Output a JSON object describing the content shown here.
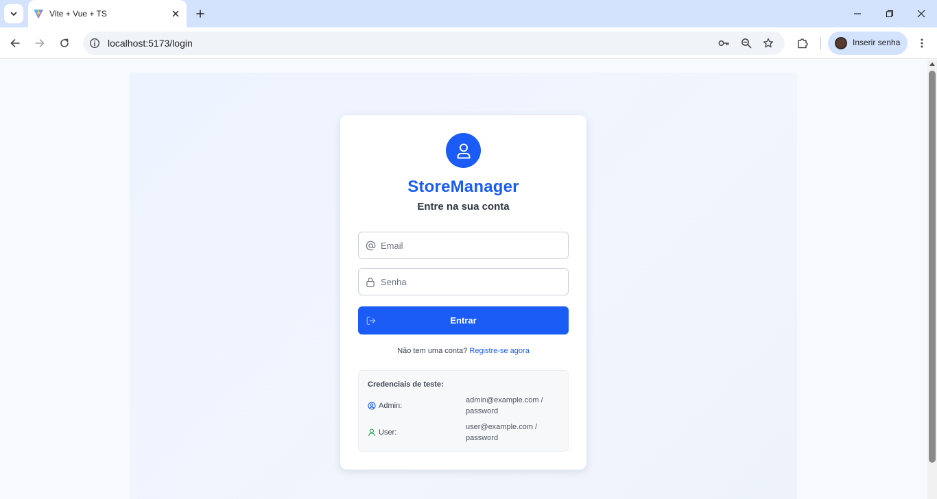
{
  "browser": {
    "tab_title": "Vite + Vue + TS",
    "url": "localhost:5173/login",
    "profile_label": "Inserir senha"
  },
  "login": {
    "brand": "StoreManager",
    "subtitle": "Entre na sua conta",
    "email_placeholder": "Email",
    "password_placeholder": "Senha",
    "submit_label": "Entrar",
    "register_prompt": "Não tem uma conta?",
    "register_link": "Registre-se agora",
    "accent_color": "#1a5cf5"
  },
  "test_credentials": {
    "title": "Credenciais de teste:",
    "accounts": [
      {
        "role": "Admin:",
        "email": "admin@example.com /",
        "password": "password",
        "icon": "user-circle-icon"
      },
      {
        "role": "User:",
        "email": "user@example.com /",
        "password": "password",
        "icon": "user-icon"
      }
    ]
  }
}
